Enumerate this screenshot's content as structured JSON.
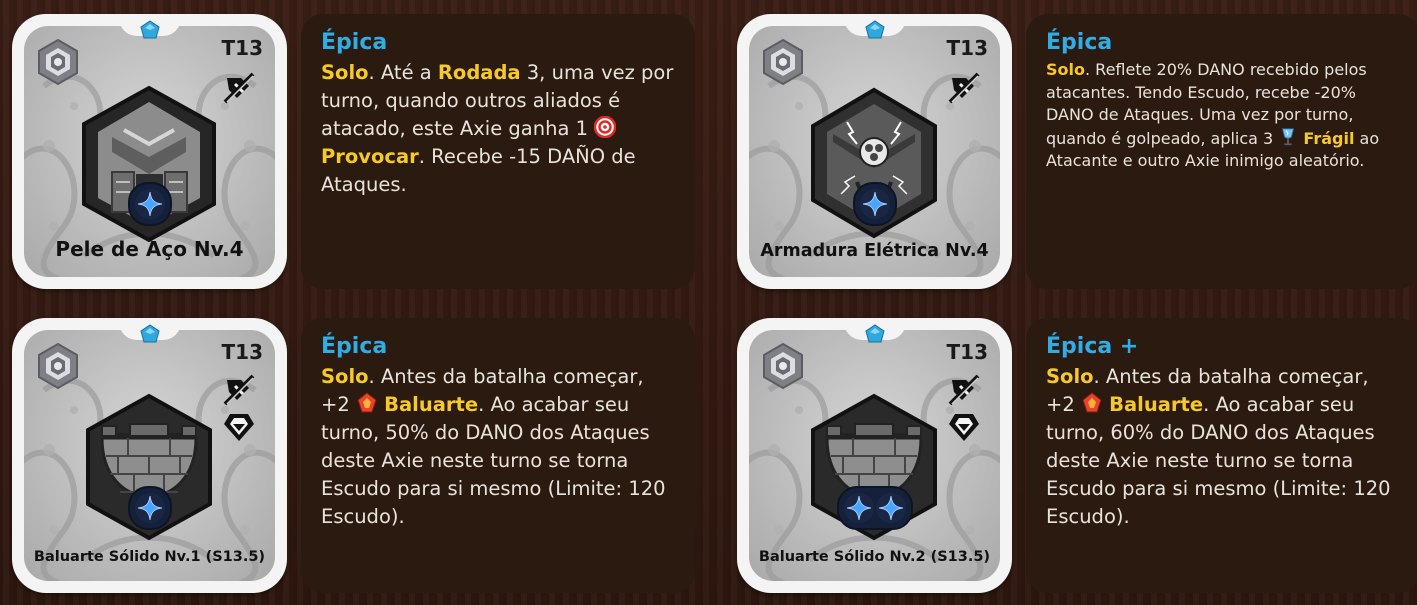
{
  "cards": [
    {
      "tier": "T13",
      "name": "Pele de Aço Nv.4",
      "rarity": "Épica",
      "level": 4,
      "text": {
        "k1": "Solo",
        "t1": ". Até a ",
        "k2": "Rodada",
        "t2": " 3, uma vez por turno, quando outros aliados é atacado, este Axie ganha 1 ",
        "k3": "Provocar",
        "t3": ". Recebe -15 DAÑO de Ataques."
      },
      "icons": [
        "steel-face-part-icon",
        "no-attack-tag-icon",
        "target-status-icon"
      ]
    },
    {
      "tier": "T13",
      "name": "Armadura Elétrica Nv.4",
      "rarity": "Épica",
      "level": 4,
      "text": {
        "k1": "Solo",
        "t1": ". Reflete 20% DANO recebido pelos atacantes. Tendo Escudo, recebe -20% DANO de Ataques. Uma vez por turno, quando é golpeado, aplica 3 ",
        "k2": "Frágil",
        "t2": " ao Atacante e outro Axie inimigo aleatório."
      },
      "icons": [
        "electric-armor-part-icon",
        "no-attack-tag-icon",
        "fragile-status-icon"
      ]
    },
    {
      "tier": "T13",
      "name": "Baluarte Sólido Nv.1 (S13.5)",
      "rarity": "Épica",
      "level": 1,
      "text": {
        "k1": "Solo",
        "t1": ". Antes da batalha começar, +2 ",
        "k2": "Baluarte",
        "t2": ". Ao acabar seu turno, 50% do DANO dos Ataques deste Axie neste turno se torna Escudo para si mesmo (Limite: 120 Escudo)."
      },
      "icons": [
        "tower-part-icon",
        "no-attack-tag-icon",
        "shield-tag-icon",
        "bulwark-status-icon"
      ]
    },
    {
      "tier": "T13",
      "name": "Baluarte Sólido Nv.2 (S13.5)",
      "rarity": "Épica +",
      "level": 2,
      "text": {
        "k1": "Solo",
        "t1": ". Antes da batalha começar, +2 ",
        "k2": "Baluarte",
        "t2": ". Ao acabar seu turno, 60% do DANO dos Ataques deste Axie neste turno se torna Escudo para si mesmo (Limite: 120 Escudo)."
      },
      "icons": [
        "tower-part-icon",
        "no-attack-tag-icon",
        "shield-tag-icon",
        "bulwark-status-icon"
      ]
    }
  ],
  "colors": {
    "rarity": "#2eaee6",
    "keyword": "#f6c928",
    "description_bg": "#2a1a10",
    "card_frame": "#f4f4f4",
    "level_gem": "#3d8cf0"
  }
}
